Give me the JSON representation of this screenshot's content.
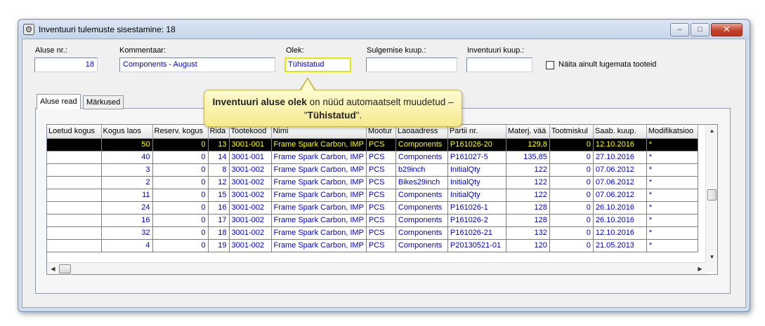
{
  "window": {
    "title": "Inventuuri tulemuste sisestamine: 18",
    "min_label": "–",
    "max_label": "□",
    "close_label": "✕"
  },
  "form": {
    "aluse_nr": {
      "label": "Aluse nr.:",
      "value": "18"
    },
    "kommentaar": {
      "label": "Kommentaar:",
      "value": "Components - August"
    },
    "olek": {
      "label": "Olek:",
      "value": "Tühistatud"
    },
    "sulgemise_kuup": {
      "label": "Sulgemise kuup.:",
      "value": ""
    },
    "inventuuri_kuup": {
      "label": "Inventuuri kuup.:",
      "value": ""
    },
    "naita_ainult": {
      "label": "Näita ainult lugemata tooteid",
      "checked": false
    }
  },
  "tabs": [
    {
      "label": "Aluse read",
      "active": true
    },
    {
      "label": "Märkused",
      "active": false
    }
  ],
  "callout": {
    "bold1": "Inventuuri aluse olek",
    "text1": " on nüüd automaatselt muudetud – \"",
    "bold2": "Tühistatud",
    "text2": "\"."
  },
  "grid": {
    "columns": [
      "Loetud kogus",
      "Kogus laos",
      "Reserv. kogus",
      "Rida",
      "Tootekood",
      "Nimi",
      "Mootur",
      "Laoaadress",
      "Partii nr.",
      "Materj. vää",
      "Tootmiskul",
      "Saab. kuup.",
      "Modifikatsioo"
    ],
    "rows": [
      [
        "",
        "50",
        "0",
        "13",
        "3001-001",
        "Frame Spark Carbon, IMP",
        "PCS",
        "Components",
        "P161026-20",
        "129,8",
        "0",
        "12.10.2016",
        "*"
      ],
      [
        "",
        "40",
        "0",
        "14",
        "3001-001",
        "Frame Spark Carbon, IMP",
        "PCS",
        "Components",
        "P161027-5",
        "135,85",
        "0",
        "27.10.2016",
        "*"
      ],
      [
        "",
        "3",
        "0",
        "8",
        "3001-002",
        "Frame Spark Carbon, IMP",
        "PCS",
        "b29inch",
        "InitialQty",
        "122",
        "0",
        "07.06.2012",
        "*"
      ],
      [
        "",
        "2",
        "0",
        "12",
        "3001-002",
        "Frame Spark Carbon, IMP",
        "PCS",
        "Bikes29inch",
        "InitialQty",
        "122",
        "0",
        "07.06.2012",
        "*"
      ],
      [
        "",
        "11",
        "0",
        "15",
        "3001-002",
        "Frame Spark Carbon, IMP",
        "PCS",
        "Components",
        "InitialQty",
        "122",
        "0",
        "07.06.2012",
        "*"
      ],
      [
        "",
        "24",
        "0",
        "16",
        "3001-002",
        "Frame Spark Carbon, IMP",
        "PCS",
        "Components",
        "P161026-1",
        "128",
        "0",
        "26.10.2016",
        "*"
      ],
      [
        "",
        "16",
        "0",
        "17",
        "3001-002",
        "Frame Spark Carbon, IMP",
        "PCS",
        "Components",
        "P161026-2",
        "128",
        "0",
        "26.10.2016",
        "*"
      ],
      [
        "",
        "32",
        "0",
        "18",
        "3001-002",
        "Frame Spark Carbon, IMP",
        "PCS",
        "Components",
        "P161026-21",
        "132",
        "0",
        "12.10.2016",
        "*"
      ],
      [
        "",
        "4",
        "0",
        "19",
        "3001-002",
        "Frame Spark Carbon, IMP",
        "PCS",
        "Components",
        "P20130521-01",
        "120",
        "0",
        "21.05.2013",
        "*"
      ]
    ],
    "selected_row": 0
  },
  "colors": {
    "cell_text": "#0000cc",
    "selected_bg": "#000000",
    "selected_text": "#ffff00",
    "highlight_border": "#e6e600"
  }
}
